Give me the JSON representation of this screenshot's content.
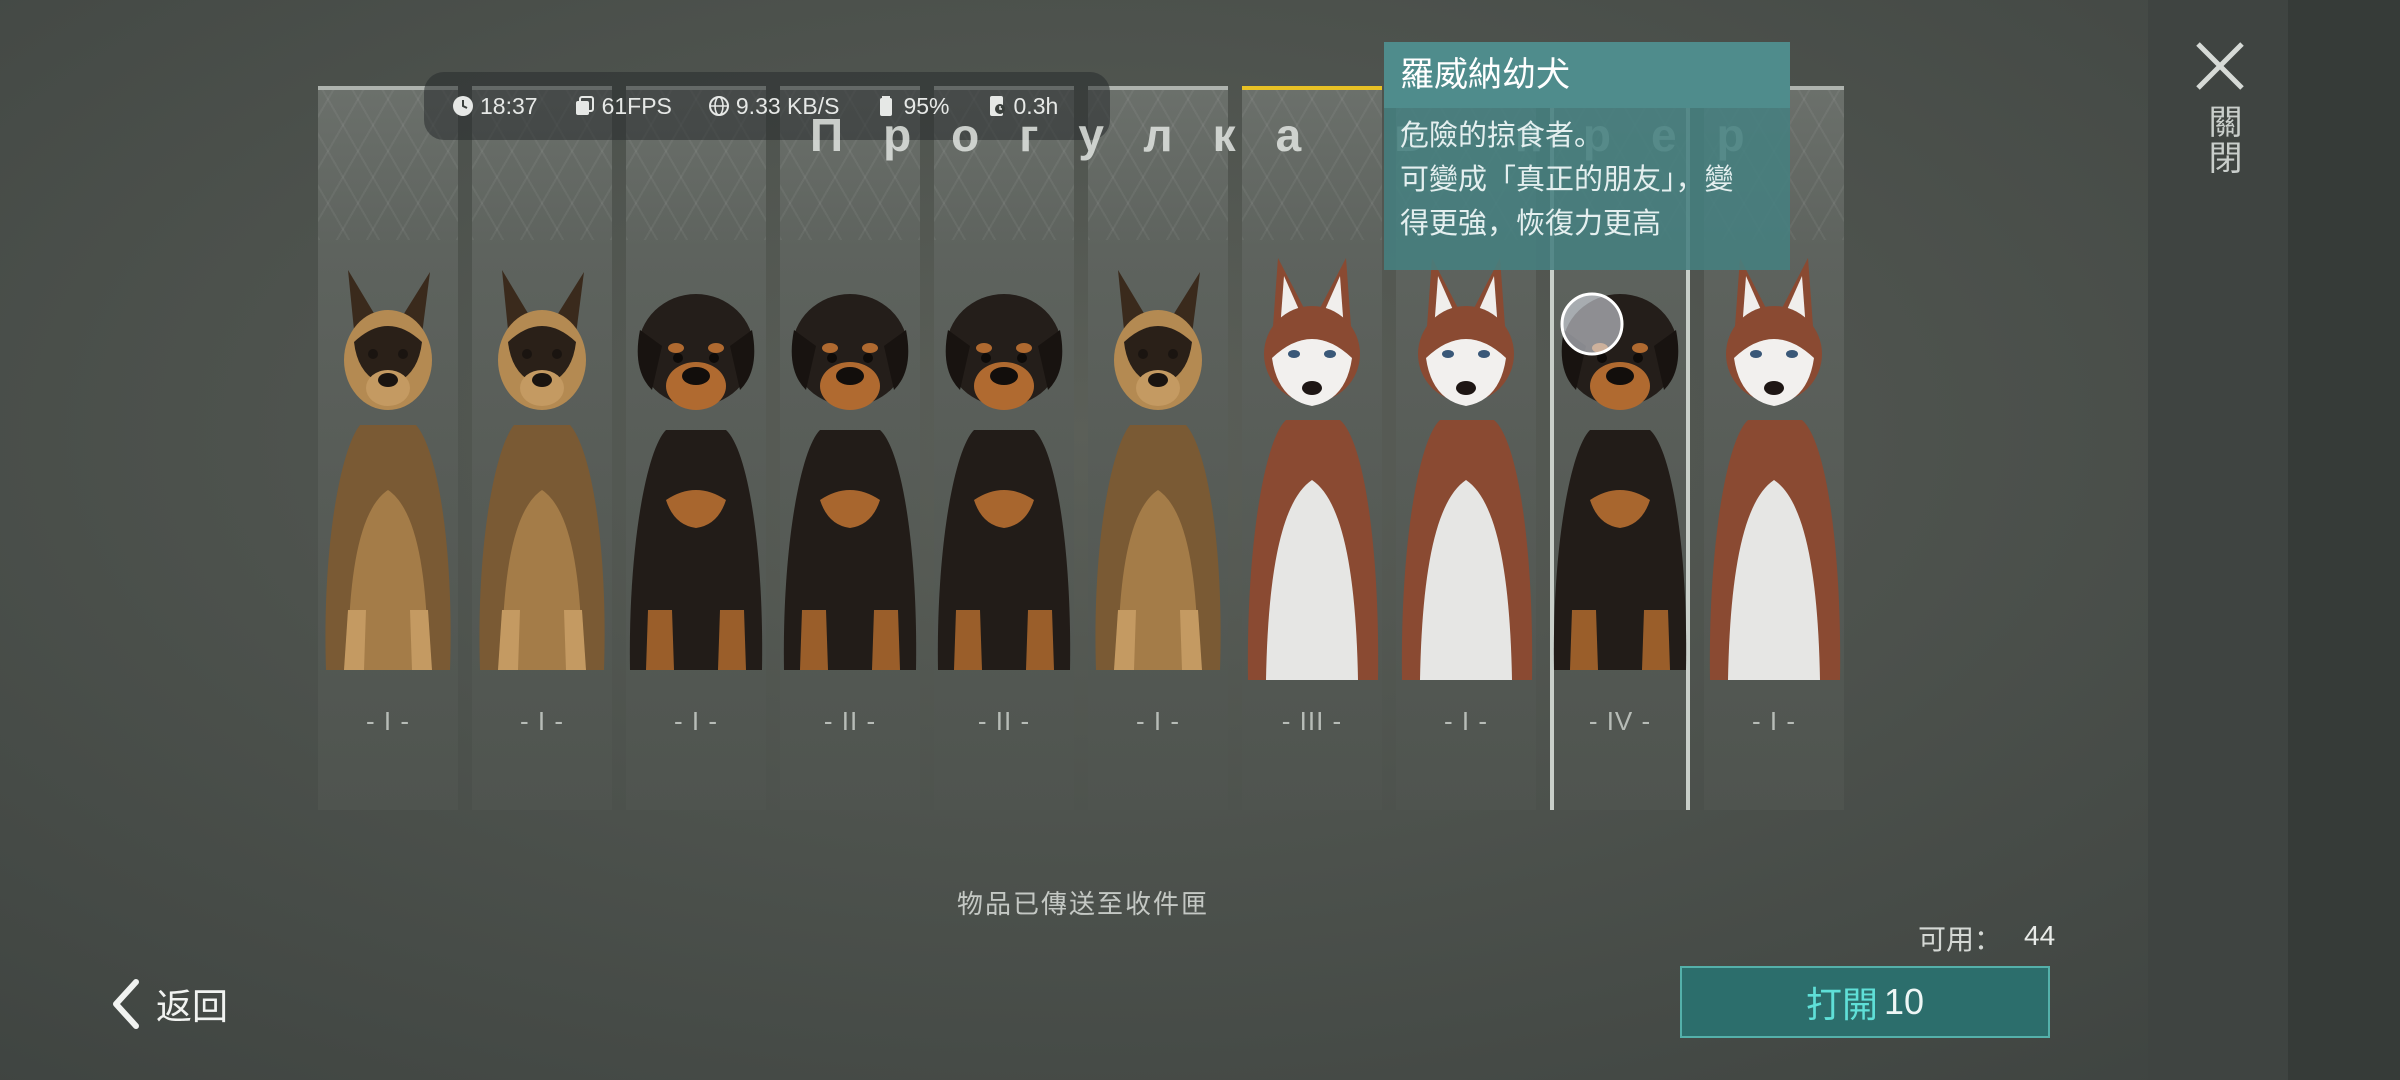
{
  "status": {
    "time": "18:37",
    "fps": "61FPS",
    "network": "9.33 KB/S",
    "battery": "95%",
    "session": "0.3h"
  },
  "overlay_text": "Прогулка в пpep",
  "cards": [
    {
      "breed": "shepherd",
      "rarity": "- I -"
    },
    {
      "breed": "shepherd",
      "rarity": "- I -"
    },
    {
      "breed": "rottweiler",
      "rarity": "- I -"
    },
    {
      "breed": "rottweiler",
      "rarity": "- II -"
    },
    {
      "breed": "rottweiler",
      "rarity": "- II -"
    },
    {
      "breed": "shepherd",
      "rarity": "- I -"
    },
    {
      "breed": "husky",
      "rarity": "- III -"
    },
    {
      "breed": "husky",
      "rarity": "- I -"
    },
    {
      "breed": "rottweiler",
      "rarity": "- IV -"
    },
    {
      "breed": "husky",
      "rarity": "- I -"
    }
  ],
  "tooltip": {
    "title": "羅威納幼犬",
    "lines": [
      "危險的掠食者。",
      "可變成「真正的朋友」，變",
      "得更強，恢復力更高"
    ]
  },
  "notice": "物品已傳送至收件匣",
  "available": {
    "label": "可用：",
    "value": "44"
  },
  "open_button": {
    "verb": "打開",
    "count": "10"
  },
  "back_button": {
    "label": "返回"
  },
  "close_button": {
    "label": "關閉"
  },
  "colors": {
    "accent_teal": "#2c6e6c",
    "accent_text": "#5fe0d8",
    "selected_border": "#e8c125",
    "tooltip_bg": "#4f8c8c"
  }
}
